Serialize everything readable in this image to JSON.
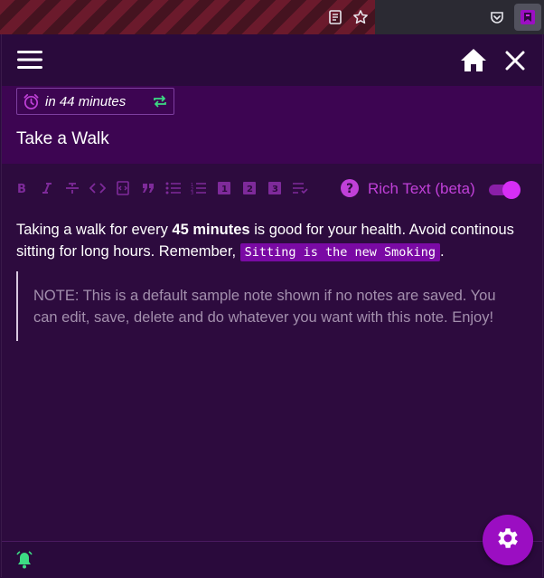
{
  "browser": {
    "icons": [
      "reader-view-icon",
      "bookmark-star-icon",
      "pocket-icon",
      "extension-icon"
    ]
  },
  "header": {
    "menu_icon": "hamburger-menu-icon",
    "home_icon": "home-icon",
    "close_icon": "close-icon"
  },
  "reminder": {
    "text": "in 44 minutes",
    "alarm_icon": "alarm-clock-icon",
    "repeat_icon": "repeat-icon"
  },
  "note": {
    "title": "Take a Walk",
    "body": {
      "part1": "Taking a walk for every ",
      "bold": "45 minutes",
      "part2": " is good for your health. Avoid continous sitting for long hours. Remember, ",
      "code": "Sitting is the new Smoking",
      "part3": "."
    },
    "quote": "NOTE: This is a default sample note shown if no notes are saved. You can edit, save, delete and do whatever you want with this note. Enjoy!"
  },
  "toolbar": {
    "tools": [
      "bold",
      "italic",
      "strikethrough",
      "code",
      "code-block",
      "blockquote",
      "bullet-list",
      "ordered-list",
      "heading-1",
      "heading-2",
      "heading-3",
      "text-align"
    ],
    "rich_text_label": "Rich Text (beta)",
    "rich_text_enabled": true
  },
  "footer": {
    "bell_icon": "bell-ringing-icon",
    "settings_icon": "gear-icon"
  },
  "colors": {
    "accent": "#c040d8",
    "title_bg": "#3d0552",
    "body_bg": "#2d0b3e",
    "bell": "#3ddc84",
    "repeat": "#3ddc84",
    "fab": "#9b0ec2"
  }
}
